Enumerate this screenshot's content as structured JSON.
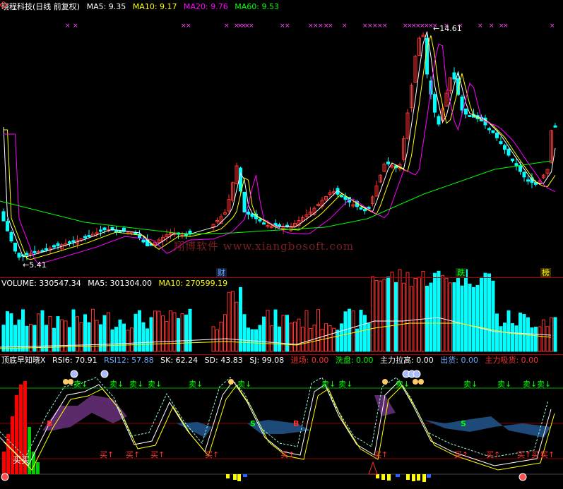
{
  "price_panel": {
    "title": "晓程科技(日线 前复权)",
    "ma_items": [
      {
        "label": "MA5: 9.35",
        "color": "#ffffff"
      },
      {
        "label": "MA10: 9.17",
        "color": "#ffff00"
      },
      {
        "label": "MA20: 9.76",
        "color": "#ff00ff"
      },
      {
        "label": "MA60: 9.53",
        "color": "#00ff00"
      }
    ],
    "high_label": "14.61",
    "low_label": "5.41",
    "watermark": "翔博软件 www.xiangbosoft.com",
    "markers": [
      {
        "text": "财",
        "color": "#6aaaff"
      },
      {
        "text": "跌",
        "color": "#00ff00"
      },
      {
        "text": "榜",
        "color": "#ffff00"
      }
    ]
  },
  "volume_panel": {
    "items": [
      {
        "label": "VOLUME: 330547.34",
        "color": "#ffffff"
      },
      {
        "label": "MA5: 301304.00",
        "color": "#ffffff"
      },
      {
        "label": "MA10: 270599.19",
        "color": "#ffff00"
      }
    ]
  },
  "indicator_panel": {
    "title": "顶底早知晓X",
    "items": [
      {
        "label": "RSI6: 70.91",
        "color": "#ffffff"
      },
      {
        "label": "RSI12: 57.88",
        "color": "#6aaaff"
      },
      {
        "label": "SK: 62.24",
        "color": "#ffffff"
      },
      {
        "label": "SD: 43.83",
        "color": "#ffffff"
      },
      {
        "label": "SJ: 99.08",
        "color": "#ffffff"
      },
      {
        "label": "进场: 0.00",
        "color": "#ff3030"
      },
      {
        "label": "洗盘: 0.00",
        "color": "#00ff00"
      },
      {
        "label": "主力拉高: 0.00",
        "color": "#ffffff"
      },
      {
        "label": "出货: 0.00",
        "color": "#6aaaff"
      },
      {
        "label": "主力吸货: 0.00",
        "color": "#ff3030"
      }
    ],
    "sell_label": "卖↓",
    "buy_label": "买↑",
    "buy_cn": "买",
    "s_label": "S",
    "b_label": "B",
    "bottom_text": "买买"
  },
  "colors": {
    "up": "#ff3030",
    "down": "#00ffff",
    "grid": "#b00000"
  }
}
